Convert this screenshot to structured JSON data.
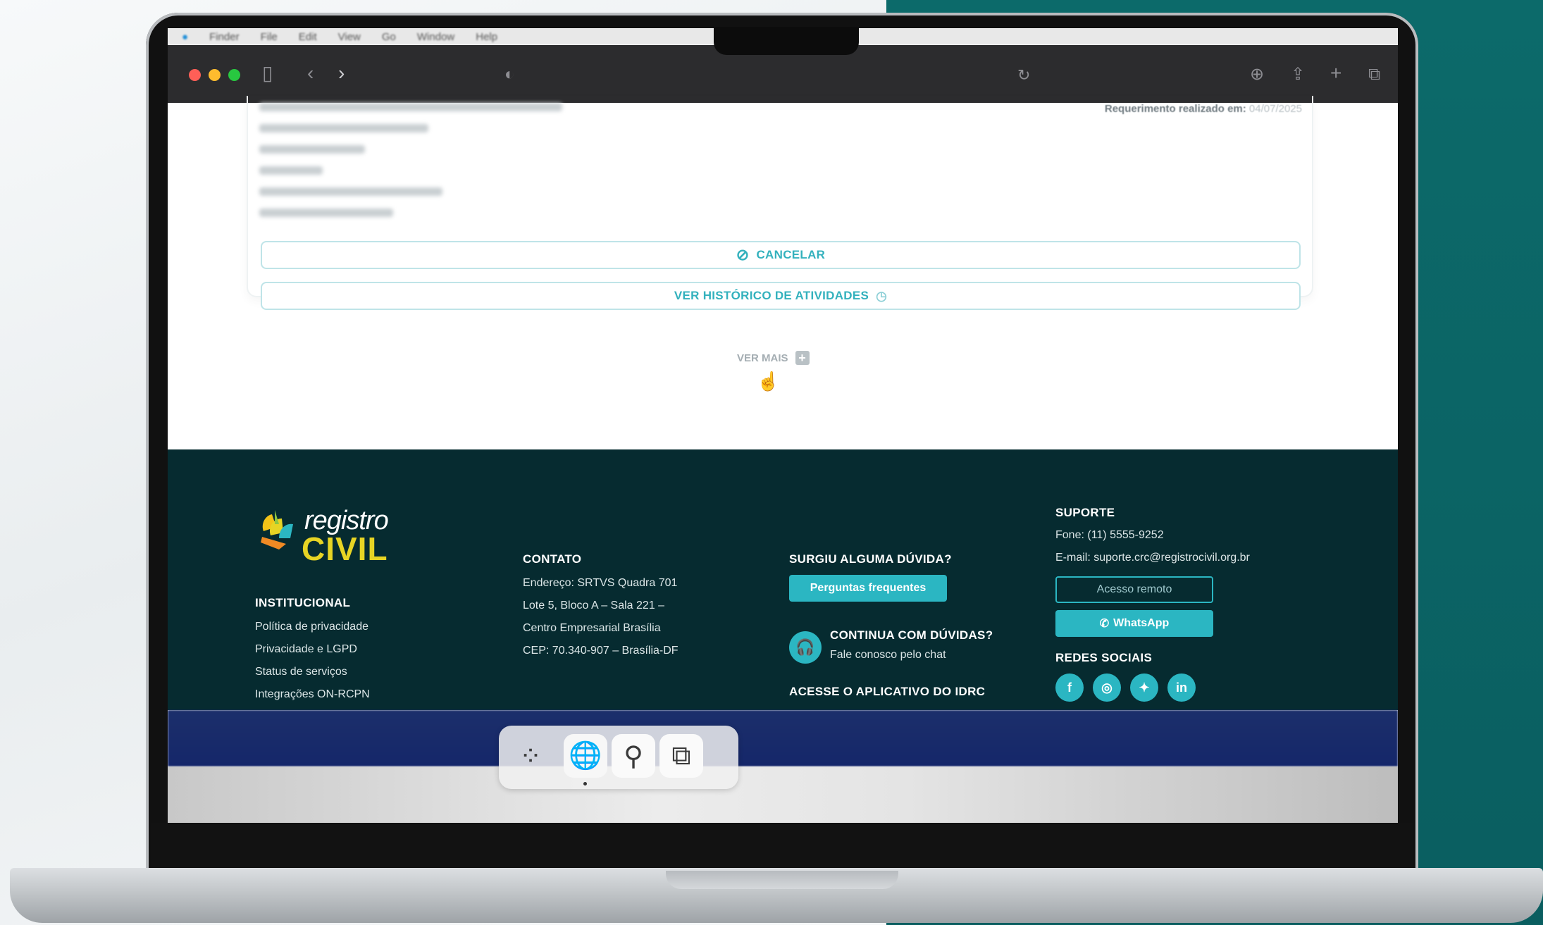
{
  "colors": {
    "accent": "#2bb6c2",
    "footer_bg": "#062b30",
    "logo_yellow": "#e7d424",
    "toolbar_bg": "#2c2c2e",
    "backdrop_teal": "#0c6a6a"
  },
  "menubar": {
    "items": [
      "Finder",
      "File",
      "Edit",
      "View",
      "Go",
      "Window",
      "Help"
    ]
  },
  "toolbar": {
    "icons": [
      "sidebar-icon",
      "back-icon",
      "forward-icon",
      "shield-icon",
      "reload-icon",
      "download-icon",
      "share-icon",
      "new-tab-icon",
      "tabs-overview-icon"
    ]
  },
  "request_card": {
    "requested_at_label": "Requerimento realizado em:",
    "requested_at_value": "04/07/2025",
    "cancel_label": "CANCELAR",
    "history_label": "VER HISTÓRICO DE ATIVIDADES"
  },
  "ver_mais": {
    "label": "VER MAIS",
    "icon": "plus-square-icon"
  },
  "footer": {
    "logo": {
      "top": "registro",
      "bottom": "CIVIL"
    },
    "institucional": {
      "title": "INSTITUCIONAL",
      "items": [
        "Política de privacidade",
        "Privacidade e LGPD",
        "Status de serviços",
        "Integrações ON-RCPN"
      ]
    },
    "contato": {
      "title": "CONTATO",
      "lines": [
        "Endereço: SRTVS Quadra 701",
        "Lote 5, Bloco A – Sala 221 –",
        "Centro Empresarial Brasília",
        "CEP: 70.340-907 – Brasília-DF"
      ]
    },
    "duvidas": {
      "title": "SURGIU ALGUMA DÚVIDA?",
      "faq_button": "Perguntas frequentes",
      "chat_title": "CONTINUA COM DÚVIDAS?",
      "chat_subtitle": "Fale conosco pelo chat",
      "app_title": "ACESSE O APLICATIVO DO IDRC"
    },
    "suporte": {
      "title": "SUPORTE",
      "phone": "Fone: (11) 5555-9252",
      "email": "E-mail: suporte.crc@registrocivil.org.br",
      "remote_button": "Acesso remoto",
      "whatsapp_button": "WhatsApp",
      "social_title": "REDES SOCIAIS",
      "social": [
        {
          "name": "facebook-icon",
          "glyph": "f"
        },
        {
          "name": "instagram-icon",
          "glyph": "◎"
        },
        {
          "name": "twitter-icon",
          "glyph": "✦"
        },
        {
          "name": "linkedin-icon",
          "glyph": "in"
        }
      ]
    }
  },
  "dock": {
    "icons": [
      "launchpad-icon",
      "globe-icon",
      "search-icon",
      "copy-icon"
    ]
  }
}
